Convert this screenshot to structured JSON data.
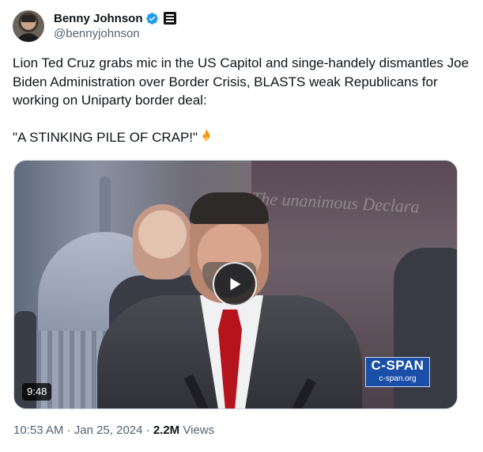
{
  "author": {
    "display_name": "Benny Johnson",
    "handle": "@bennyjohnson",
    "avatar_icon": "avatar-photo",
    "verified_icon": "verified-badge-icon",
    "affiliation_icon": "news-organization-badge-icon"
  },
  "tweet": {
    "text": "Lion Ted Cruz grabs mic in the US Capitol and singe-handely dismantles Joe Biden Administration over Border Crisis, BLASTS weak Republicans for working on Uniparty border deal:\n\n\"A STINKING PILE OF CRAP!\"",
    "emoji_icon": "fire-icon"
  },
  "media": {
    "type": "video",
    "duration": "9:48",
    "play_icon": "play-icon",
    "banner_text": "The unanimous Declara",
    "watermark": {
      "line1": "C-SPAN",
      "line2": "c-span.org"
    }
  },
  "meta": {
    "time": "10:53 AM",
    "separator": "·",
    "date": "Jan 25, 2024",
    "views_count": "2.2M",
    "views_label": "Views"
  },
  "colors": {
    "text_primary": "#0f1419",
    "text_secondary": "#536471",
    "verified_blue": "#1d9bf0",
    "border": "#cfd9de"
  }
}
